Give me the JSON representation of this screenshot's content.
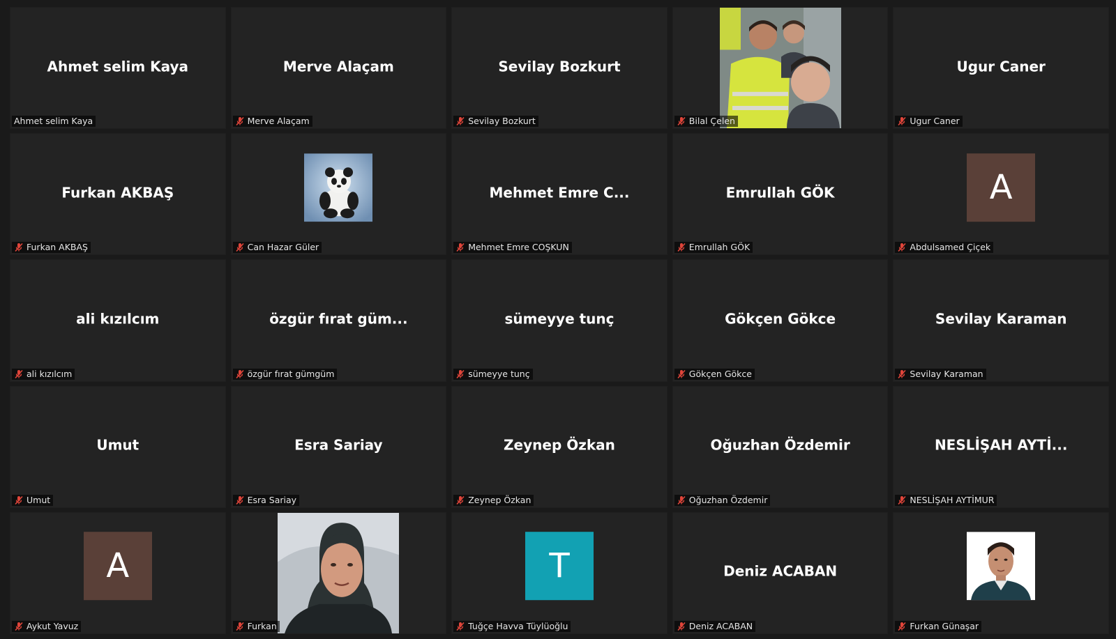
{
  "colors": {
    "background": "#1a1a1a",
    "tile": "#232323",
    "muted_mic": "#e0453a",
    "avatar_brown": "#5a4038",
    "avatar_teal": "#12a1b3"
  },
  "participants": [
    {
      "display": "Ahmet selim Kaya",
      "tag": "Ahmet selim Kaya",
      "muted": false,
      "media": "name"
    },
    {
      "display": "Merve Alaçam",
      "tag": "Merve Alaçam",
      "muted": true,
      "media": "name"
    },
    {
      "display": "Sevilay Bozkurt",
      "tag": "Sevilay Bozkurt",
      "muted": true,
      "media": "name"
    },
    {
      "display": "",
      "tag": "Bilal Çelen",
      "muted": true,
      "media": "photo-wide",
      "icon": "group-photo"
    },
    {
      "display": "Ugur Caner",
      "tag": "Ugur Caner",
      "muted": true,
      "media": "name"
    },
    {
      "display": "Furkan AKBAŞ",
      "tag": "Furkan AKBAŞ",
      "muted": true,
      "media": "name"
    },
    {
      "display": "",
      "tag": "Can Hazar Güler",
      "muted": true,
      "media": "photo-square",
      "icon": "panda-photo"
    },
    {
      "display": "Mehmet Emre C...",
      "tag": "Mehmet Emre COŞKUN",
      "muted": true,
      "media": "name"
    },
    {
      "display": "Emrullah GÖK",
      "tag": "Emrullah GÖK",
      "muted": true,
      "media": "name"
    },
    {
      "display": "A",
      "tag": "Abdulsamed Çiçek",
      "muted": true,
      "media": "avatar",
      "avatar_color": "#5a4038"
    },
    {
      "display": "ali kızılcım",
      "tag": "ali kızılcım",
      "muted": true,
      "media": "name"
    },
    {
      "display": "özgür fırat güm...",
      "tag": "özgür fırat gümgüm",
      "muted": true,
      "media": "name"
    },
    {
      "display": "sümeyye tunç",
      "tag": "sümeyye tunç",
      "muted": true,
      "media": "name"
    },
    {
      "display": "Gökçen Gökce",
      "tag": "Gökçen Gökce",
      "muted": true,
      "media": "name"
    },
    {
      "display": "Sevilay Karaman",
      "tag": "Sevilay Karaman",
      "muted": true,
      "media": "name"
    },
    {
      "display": "Umut",
      "tag": "Umut",
      "muted": true,
      "media": "name"
    },
    {
      "display": "Esra Sariay",
      "tag": "Esra Sariay",
      "muted": true,
      "media": "name"
    },
    {
      "display": "Zeynep Özkan",
      "tag": "Zeynep Özkan",
      "muted": true,
      "media": "name"
    },
    {
      "display": "Oğuzhan Özdemir",
      "tag": "Oğuzhan Özdemir",
      "muted": true,
      "media": "name"
    },
    {
      "display": "NESLİŞAH  AYTİ...",
      "tag": "NESLİŞAH AYTİMUR",
      "muted": true,
      "media": "name"
    },
    {
      "display": "A",
      "tag": "Aykut Yavuz",
      "muted": true,
      "media": "avatar",
      "avatar_color": "#5a4038"
    },
    {
      "display": "",
      "tag": "Furkan",
      "muted": true,
      "media": "photo-wide",
      "icon": "person-photo"
    },
    {
      "display": "T",
      "tag": "Tuğçe Havva Tüylüoğlu",
      "muted": true,
      "media": "avatar",
      "avatar_color": "#12a1b3"
    },
    {
      "display": "Deniz ACABAN",
      "tag": "Deniz ACABAN",
      "muted": true,
      "media": "name"
    },
    {
      "display": "",
      "tag": "Furkan Günaşar",
      "muted": true,
      "media": "photo-square",
      "icon": "portrait-photo"
    }
  ]
}
